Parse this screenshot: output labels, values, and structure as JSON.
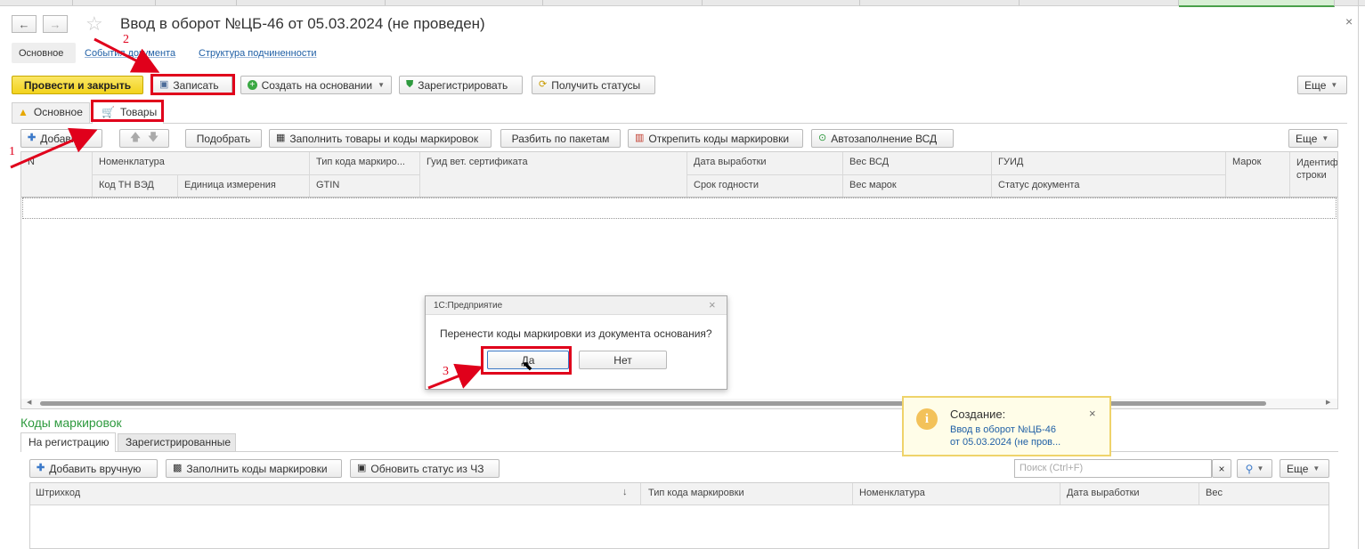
{
  "window": {
    "title": "Ввод в оборот №ЦБ-46 от 05.03.2024 (не проведен)",
    "close": "×"
  },
  "nav": {
    "back": "←",
    "forward": "→",
    "star": "☆"
  },
  "section_links": [
    "Основное",
    "События документа",
    "Структура подчиненности"
  ],
  "toolbar": {
    "post_close": "Провести и закрыть",
    "save": "Записать",
    "create_based": "Создать на основании",
    "register": "Зарегистрировать",
    "get_statuses": "Получить статусы",
    "more": "Еще"
  },
  "tabs": {
    "main": "Основное",
    "goods": "Товары"
  },
  "goods_toolbar": {
    "add": "Добавить",
    "pick": "Подобрать",
    "fill_codes": "Заполнить товары и коды маркировок",
    "split": "Разбить по пакетам",
    "unpin": "Открепить коды маркировки",
    "autofill": "Автозаполнение ВСД",
    "more": "Еще"
  },
  "goods_table": {
    "row1": [
      "N",
      "Номенклатура",
      "Тип кода маркиро...",
      "Гуид вет. сертификата",
      "Дата выработки",
      "Вес ВСД",
      "ГУИД",
      "Марок",
      "Идентиф строки"
    ],
    "row2": [
      "Код ТН ВЭД",
      "Единица измерения",
      "GTIN",
      "Срок годности",
      "Вес марок",
      "Статус документа"
    ]
  },
  "dialog": {
    "title": "1С:Предприятие",
    "message": "Перенести коды маркировки из документа основания?",
    "yes": "Да",
    "no": "Нет",
    "close": "×"
  },
  "notification": {
    "heading": "Создание:",
    "link_line1": "Ввод в оборот №ЦБ-46",
    "link_line2": "от 05.03.2024 (не пров...",
    "close": "×"
  },
  "codes": {
    "section_title": "Коды маркировок",
    "tab_active": "На регистрацию",
    "tab_other": "Зарегистрированные",
    "add_manual": "Добавить вручную",
    "fill_codes": "Заполнить коды маркировки",
    "refresh_status": "Обновить статус из ЧЗ",
    "search_placeholder": "Поиск (Ctrl+F)",
    "more": "Еще",
    "columns": [
      "Штрихкод",
      "Тип кода маркировки",
      "Номенклатура",
      "Дата выработки",
      "Вес"
    ]
  },
  "annotations": [
    "1",
    "2",
    "3"
  ],
  "colors": {
    "primary_button": "#f7dc3a",
    "annotation_red": "#e0001b",
    "link_blue": "#1f5fa5",
    "section_green": "#2e9a3e"
  }
}
